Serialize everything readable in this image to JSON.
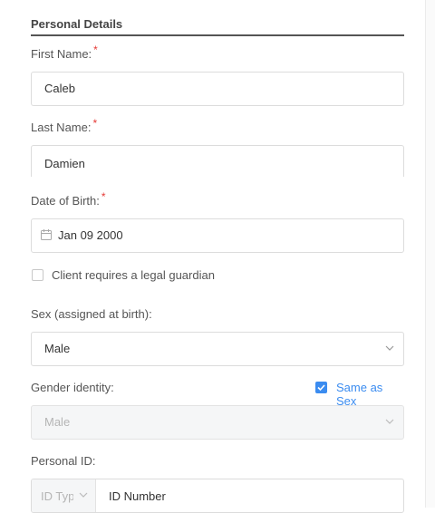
{
  "section": {
    "title": "Personal Details"
  },
  "first_name": {
    "label": "First Name:",
    "required_mark": "*",
    "value": "Caleb"
  },
  "last_name": {
    "label": "Last Name:",
    "required_mark": "*",
    "value": "Damien"
  },
  "dob": {
    "label": "Date of Birth:",
    "required_mark": "*",
    "value": "Jan 09 2000"
  },
  "guardian": {
    "label": "Client requires a legal guardian",
    "checked": false
  },
  "sex": {
    "label": "Sex (assigned at birth):",
    "value": "Male"
  },
  "gender": {
    "label": "Gender identity:",
    "same_as_sex_label": "Same as Sex",
    "same_as_sex_checked": true,
    "value": "Male"
  },
  "personal_id": {
    "label": "Personal ID:",
    "type_placeholder": "ID Type",
    "number_placeholder": "ID Number"
  },
  "colors": {
    "accent": "#3b8cf0",
    "required": "#e53935"
  }
}
